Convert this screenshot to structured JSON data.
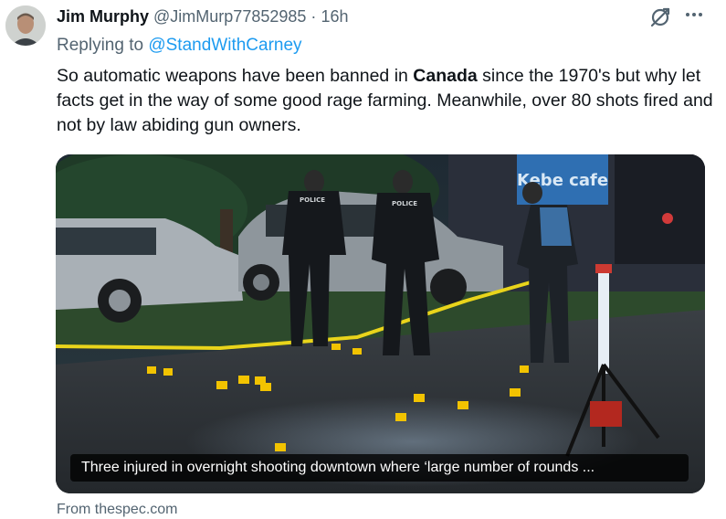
{
  "author": {
    "display_name": "Jim Murphy",
    "handle": "@JimMurp77852985",
    "separator": "·",
    "time": "16h"
  },
  "icons": {
    "avatar": "avatar",
    "grok": "grok-icon",
    "more": "more-options-icon"
  },
  "reply": {
    "prefix": "Replying to",
    "mention": "@StandWithCarney"
  },
  "tweet": {
    "text_before": "So automatic weapons have been banned in ",
    "bold_word": "Canada",
    "text_after": " since the 1970's but why let facts get in the way of some good rage farming. Meanwhile, over 80 shots fired and not by law abiding gun owners."
  },
  "card": {
    "caption": "Three injured in overnight shooting downtown where ‘large number of rounds ...",
    "source": "From thespec.com",
    "sign_text": "Kebe cafe",
    "police_label": "POLICE"
  },
  "colors": {
    "link": "#1d9bf0",
    "secondary_text": "#536471",
    "caution_tape": "#e9d41b",
    "evidence_marker": "#f2c300"
  }
}
